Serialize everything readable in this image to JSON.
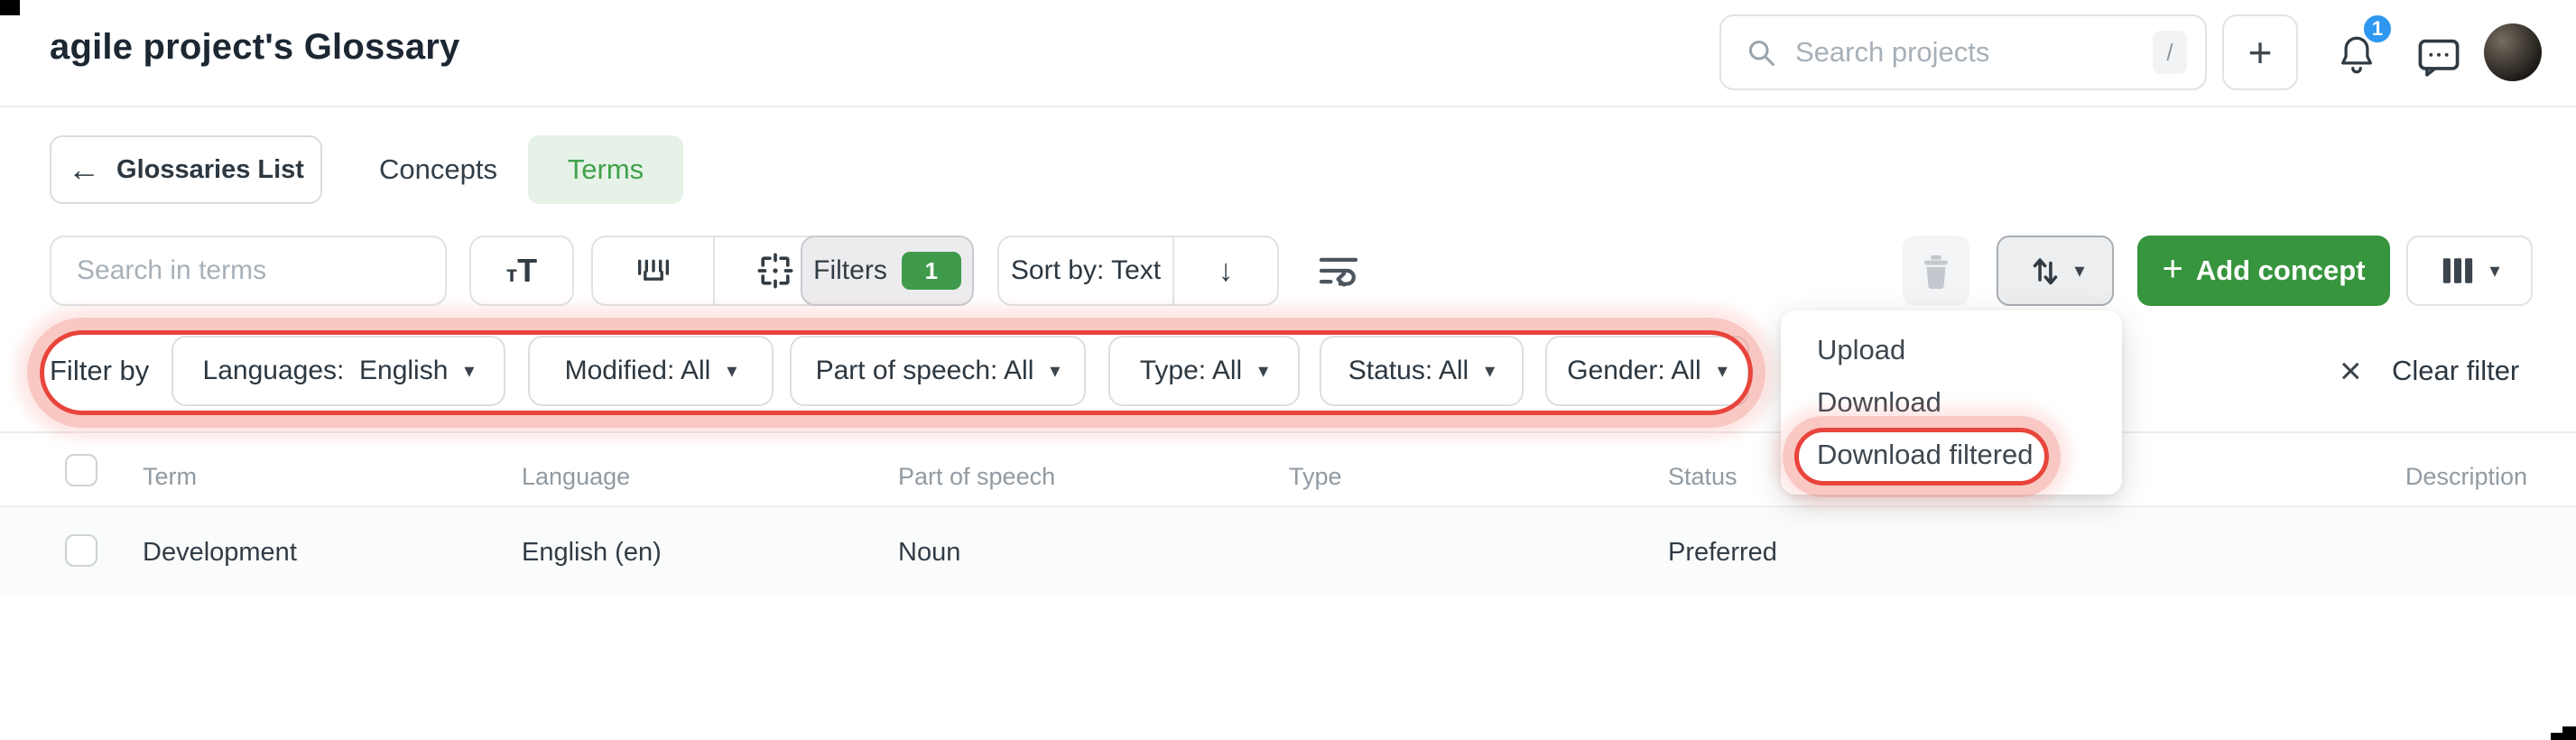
{
  "app": {
    "title": "agile project's Glossary"
  },
  "topbar": {
    "search_placeholder": "Search projects",
    "search_shortcut": "/",
    "notification_count": "1"
  },
  "icons": {
    "plus": "+",
    "back_arrow": "←",
    "sort_down_arrow": "↓",
    "caret_down": "▾",
    "clear_x": "×",
    "match_case": "тT"
  },
  "nav": {
    "back_label": "Glossaries List",
    "tab_concepts": "Concepts",
    "tab_terms": "Terms"
  },
  "toolbar": {
    "search_placeholder": "Search in terms",
    "filters_label": "Filters",
    "filters_badge": "1",
    "sort_label": "Sort by: Text",
    "add_concept_label": "Add concept"
  },
  "filter_bar": {
    "label": "Filter by",
    "pills": [
      "Languages:  English",
      "Modified: All",
      "Part of speech: All",
      "Type: All",
      "Status: All",
      "Gender: All"
    ],
    "clear_label": "Clear filter"
  },
  "export_menu": {
    "items": [
      "Upload",
      "Download",
      "Download filtered"
    ],
    "highlighted_item": "Download filtered"
  },
  "table": {
    "headers": [
      "Term",
      "Language",
      "Part of speech",
      "Type",
      "Status",
      "Description"
    ],
    "rows": [
      {
        "term": "Development",
        "language": "English (en)",
        "part_of_speech": "Noun",
        "type": "",
        "status": "Preferred",
        "description": ""
      }
    ]
  },
  "colors": {
    "accent_green": "#37953e",
    "tab_green_bg": "#e6f2e7",
    "badge_blue": "#2f97f0",
    "annotation_red": "#e8443c"
  }
}
